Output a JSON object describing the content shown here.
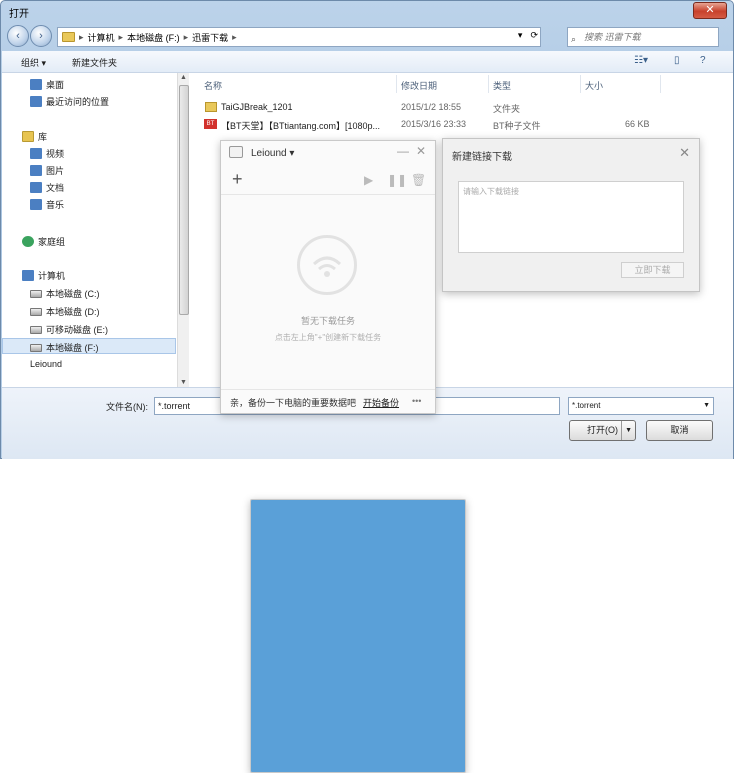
{
  "window": {
    "title": "打开",
    "close_label": "✕"
  },
  "nav": {
    "back_label": "‹",
    "forward_label": "›",
    "breadcrumb": [
      "计算机",
      "本地磁盘 (F:)",
      "迅雷下载"
    ],
    "search_placeholder": "搜索 迅雷下载"
  },
  "toolbar": {
    "organize_label": "组织 ▾",
    "new_folder_label": "新建文件夹"
  },
  "sidebar": {
    "items": [
      {
        "label": "桌面",
        "icon": "desktop-icon"
      },
      {
        "label": "最近访问的位置",
        "icon": "recent-icon"
      },
      {
        "label": "库",
        "icon": "library-icon"
      },
      {
        "label": "视频",
        "icon": "video-icon"
      },
      {
        "label": "图片",
        "icon": "picture-icon"
      },
      {
        "label": "文档",
        "icon": "document-icon"
      },
      {
        "label": "音乐",
        "icon": "music-icon"
      },
      {
        "label": "家庭组",
        "icon": "homegroup-icon"
      },
      {
        "label": "计算机",
        "icon": "computer-icon"
      },
      {
        "label": "本地磁盘 (C:)",
        "icon": "drive-icon"
      },
      {
        "label": "本地磁盘 (D:)",
        "icon": "drive-icon"
      },
      {
        "label": "可移动磁盘 (E:)",
        "icon": "drive-icon"
      },
      {
        "label": "本地磁盘 (F:)",
        "icon": "drive-icon"
      },
      {
        "label": "Leiound",
        "icon": "leiound-icon"
      }
    ]
  },
  "filelist": {
    "columns": [
      "名称",
      "修改日期",
      "类型",
      "大小"
    ],
    "rows": [
      {
        "name": "TaiGJBreak_1201",
        "date": "2015/1/2 18:55",
        "type": "文件夹",
        "size": ""
      },
      {
        "name": "【BT天堂】【BTtiantang.com】[1080p...",
        "date": "2015/3/16 23:33",
        "type": "BT种子文件",
        "size": "66 KB"
      }
    ]
  },
  "bottom": {
    "filename_label": "文件名(N):",
    "filename_value": "*.torrent",
    "filter_value": "*.torrent",
    "open_label": "打开(O)",
    "cancel_label": "取消"
  },
  "leiound": {
    "name": "Leiound ▾",
    "empty_title": "暂无下载任务",
    "empty_hint": "点击左上角\"+\"创建新下载任务",
    "footer_text": "亲，备份一下电脑的重要数据吧",
    "footer_link": "开始备份",
    "more_label": "•••"
  },
  "new_link_dialog": {
    "title": "新建链接下载",
    "placeholder": "请输入下载链接",
    "download_label": "立即下载"
  }
}
